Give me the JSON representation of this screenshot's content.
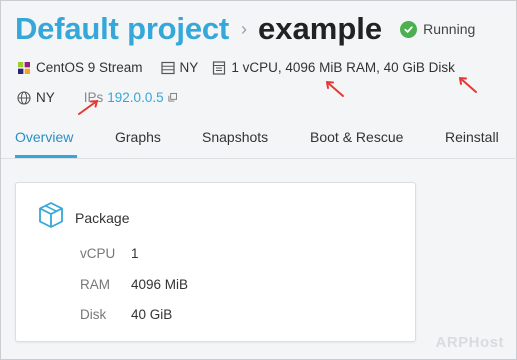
{
  "header": {
    "project": "Default project",
    "separator": "›",
    "server_name": "example",
    "status": "Running",
    "status_color": "#4caf50"
  },
  "meta": {
    "os": "CentOS 9 Stream",
    "region": "NY",
    "plan": "1 vCPU, 4096 MiB RAM, 40 GiB Disk",
    "location": "NY",
    "ips_label": "IPs",
    "ip": "192.0.0.5"
  },
  "tabs": [
    {
      "label": "Overview",
      "active": true
    },
    {
      "label": "Graphs"
    },
    {
      "label": "Snapshots"
    },
    {
      "label": "Boot & Rescue"
    },
    {
      "label": "Reinstall"
    }
  ],
  "package": {
    "title": "Package",
    "specs": [
      {
        "label": "vCPU",
        "value": "1"
      },
      {
        "label": "RAM",
        "value": "4096 MiB"
      },
      {
        "label": "Disk",
        "value": "40 GiB"
      }
    ]
  },
  "colors": {
    "accent": "#35a7d9",
    "annotation_arrow": "#e53935"
  },
  "watermark": "ARPHost"
}
